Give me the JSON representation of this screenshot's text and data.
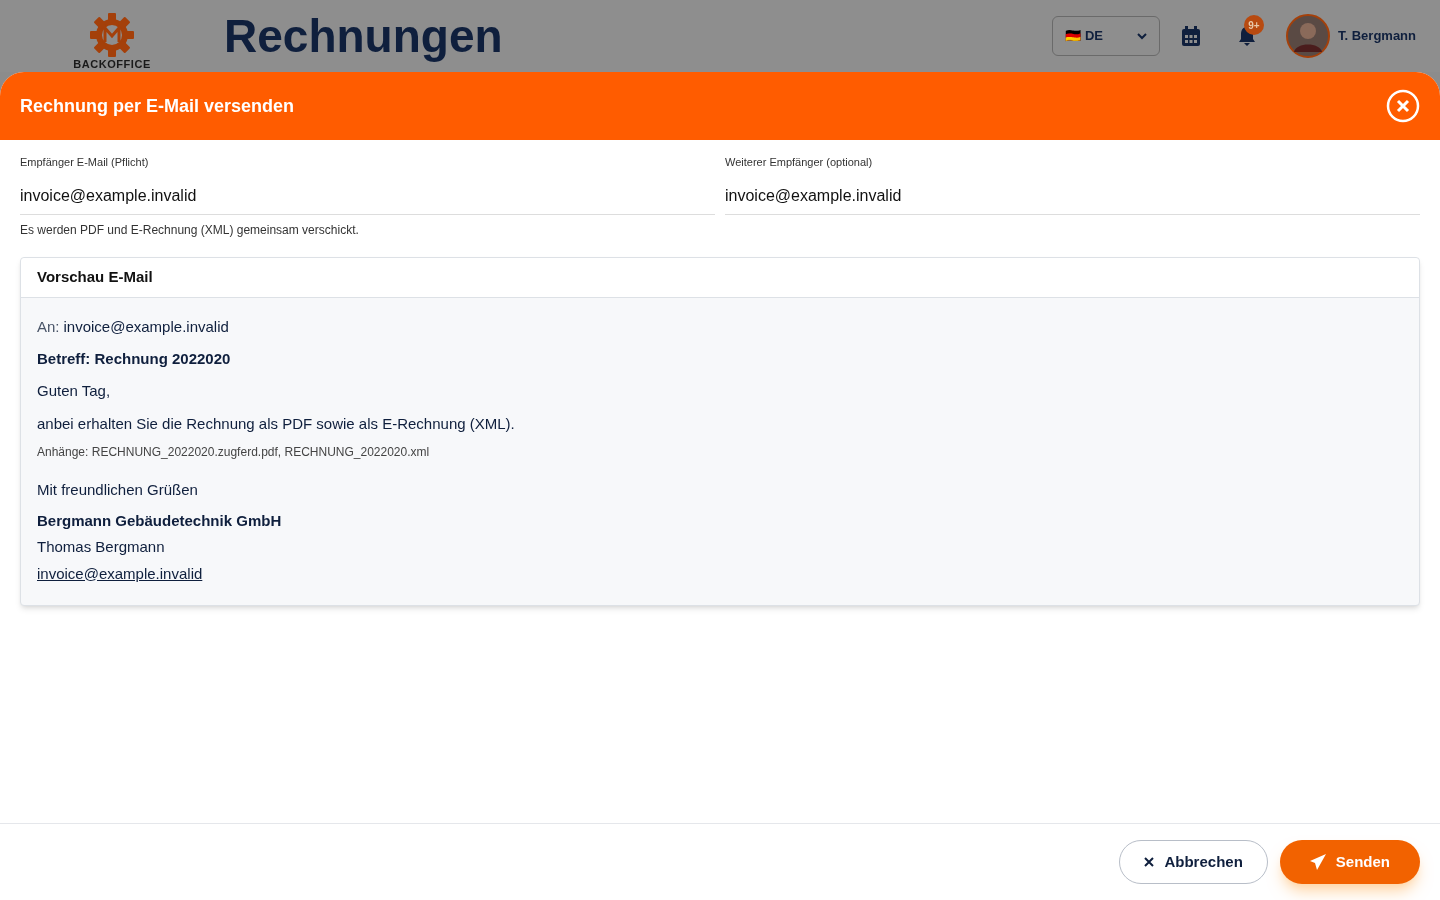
{
  "app_header": {
    "logo_text": "BACKOFFICE",
    "title": "Rechnungen",
    "language": {
      "flag": "🇩🇪",
      "label": "DE"
    },
    "notifications_badge": "9+",
    "user_name": "T. Bergmann"
  },
  "dialog": {
    "title": "Rechnung per E-Mail versenden",
    "fields": [
      {
        "label": "Empfänger E-Mail (Pflicht)",
        "value": "invoice@example.invalid"
      },
      {
        "label": "Weiterer Empfänger (optional)",
        "value": "invoice@example.invalid"
      }
    ],
    "hint": "Es werden PDF und E-Rechnung (XML) gemeinsam verschickt.",
    "preview": {
      "title": "Vorschau E-Mail",
      "to_label": "An:",
      "to": "invoice@example.invalid",
      "subject": "Betreff: Rechnung 2022020",
      "greeting": "Guten Tag,",
      "body": "anbei erhalten Sie die Rechnung als PDF sowie als E-Rechnung (XML).",
      "attachments": "Anhänge: RECHNUNG_2022020.zugferd.pdf, RECHNUNG_2022020.xml",
      "closing": "Mit freundlichen Grüßen",
      "company": "Bergmann Gebäudetechnik GmbH",
      "sender": "Thomas Bergmann",
      "email": "invoice@example.invalid"
    },
    "buttons": [
      {
        "kind": "cancel",
        "label": "Abbrechen"
      },
      {
        "kind": "send",
        "label": "Senden"
      }
    ]
  }
}
